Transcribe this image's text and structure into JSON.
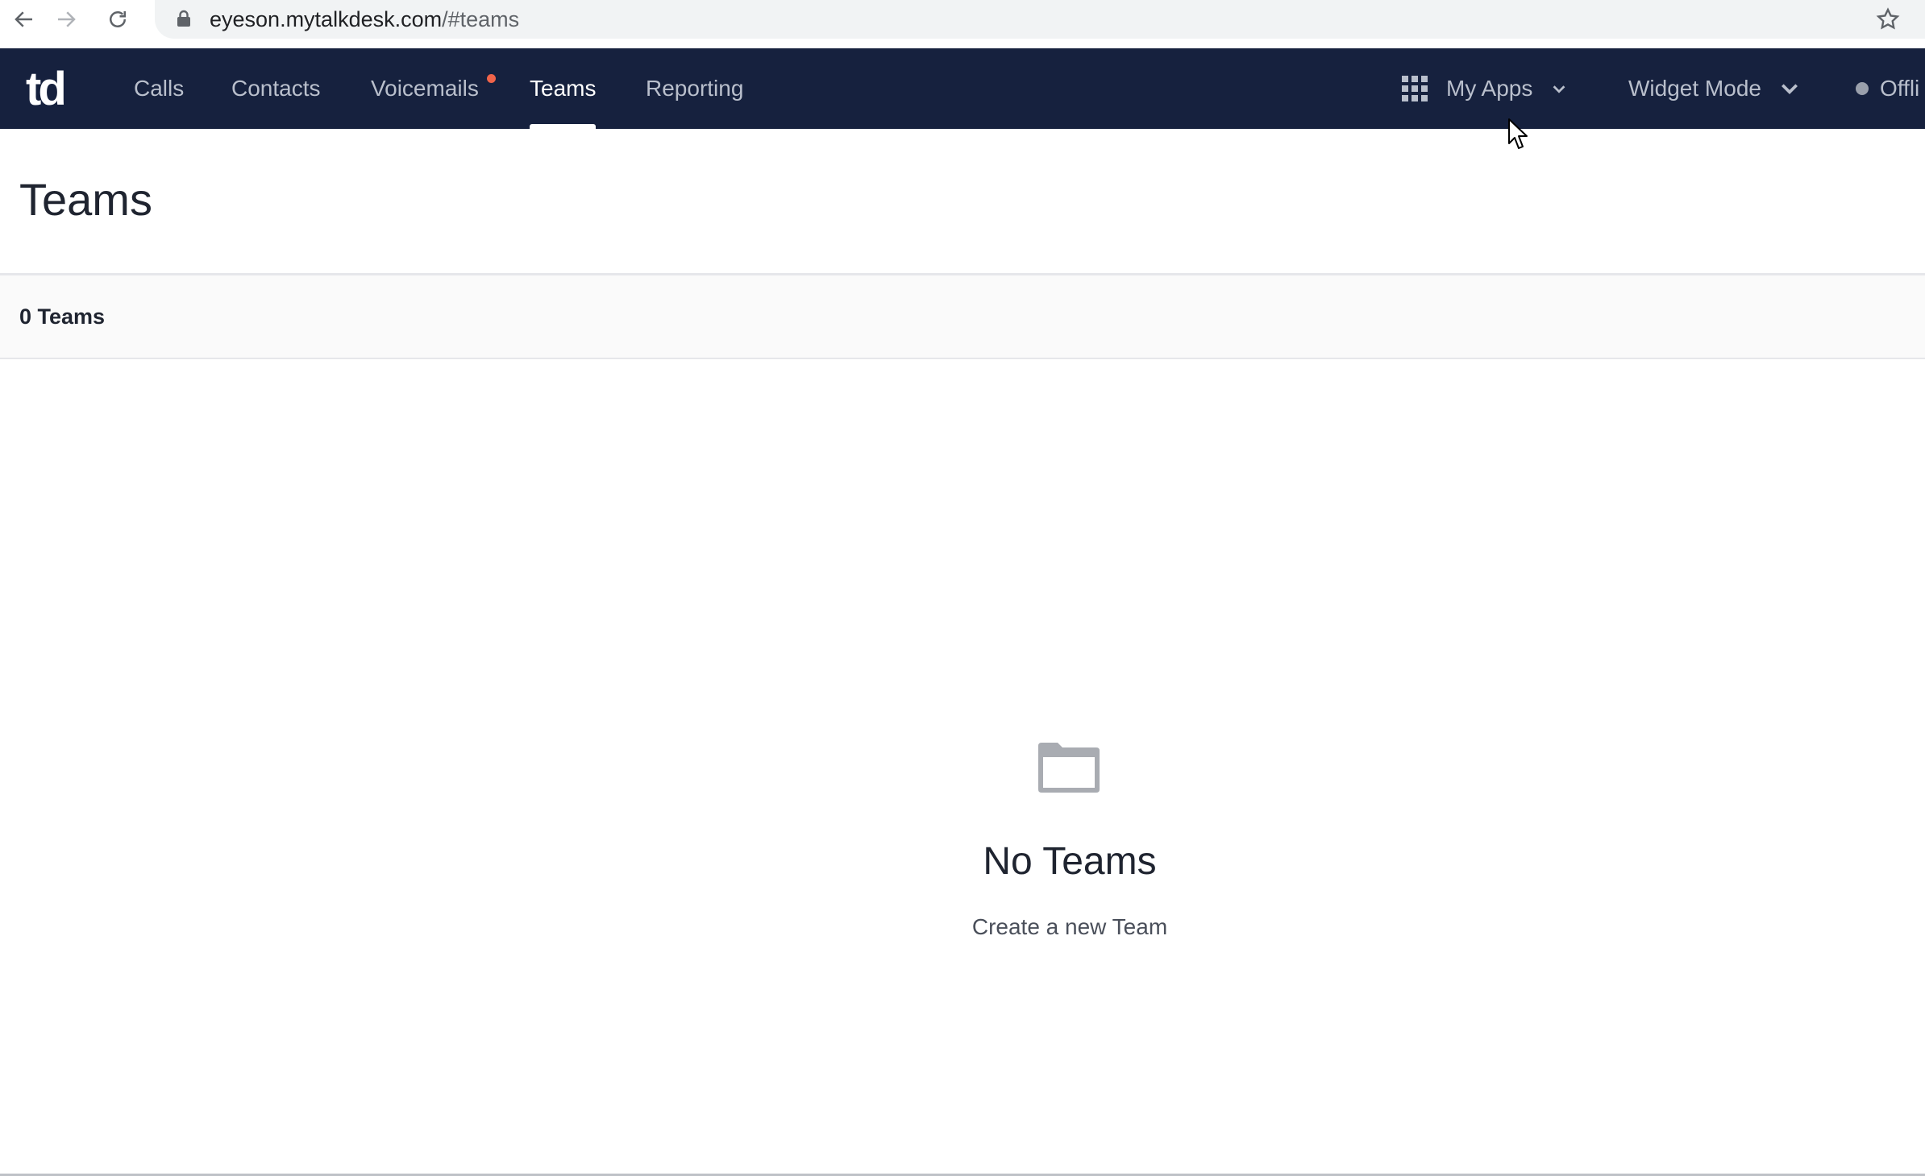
{
  "browser": {
    "url_host": "eyeson.mytalkdesk.com",
    "url_path": "/#teams"
  },
  "nav": {
    "logo_text": "td",
    "tabs": [
      {
        "label": "Calls",
        "active": false
      },
      {
        "label": "Contacts",
        "active": false
      },
      {
        "label": "Voicemails",
        "active": false,
        "has_notification": true
      },
      {
        "label": "Teams",
        "active": true
      },
      {
        "label": "Reporting",
        "active": false
      }
    ],
    "my_apps_label": "My Apps",
    "widget_mode_label": "Widget Mode",
    "status_label": "Offli"
  },
  "page": {
    "title": "Teams",
    "count_label": "0 Teams"
  },
  "empty_state": {
    "icon": "folder-icon",
    "title": "No Teams",
    "subtitle": "Create a new Team"
  },
  "colors": {
    "nav_background": "#16213e",
    "notification_dot": "#f0644a",
    "status_dot": "#9aa0ac"
  }
}
